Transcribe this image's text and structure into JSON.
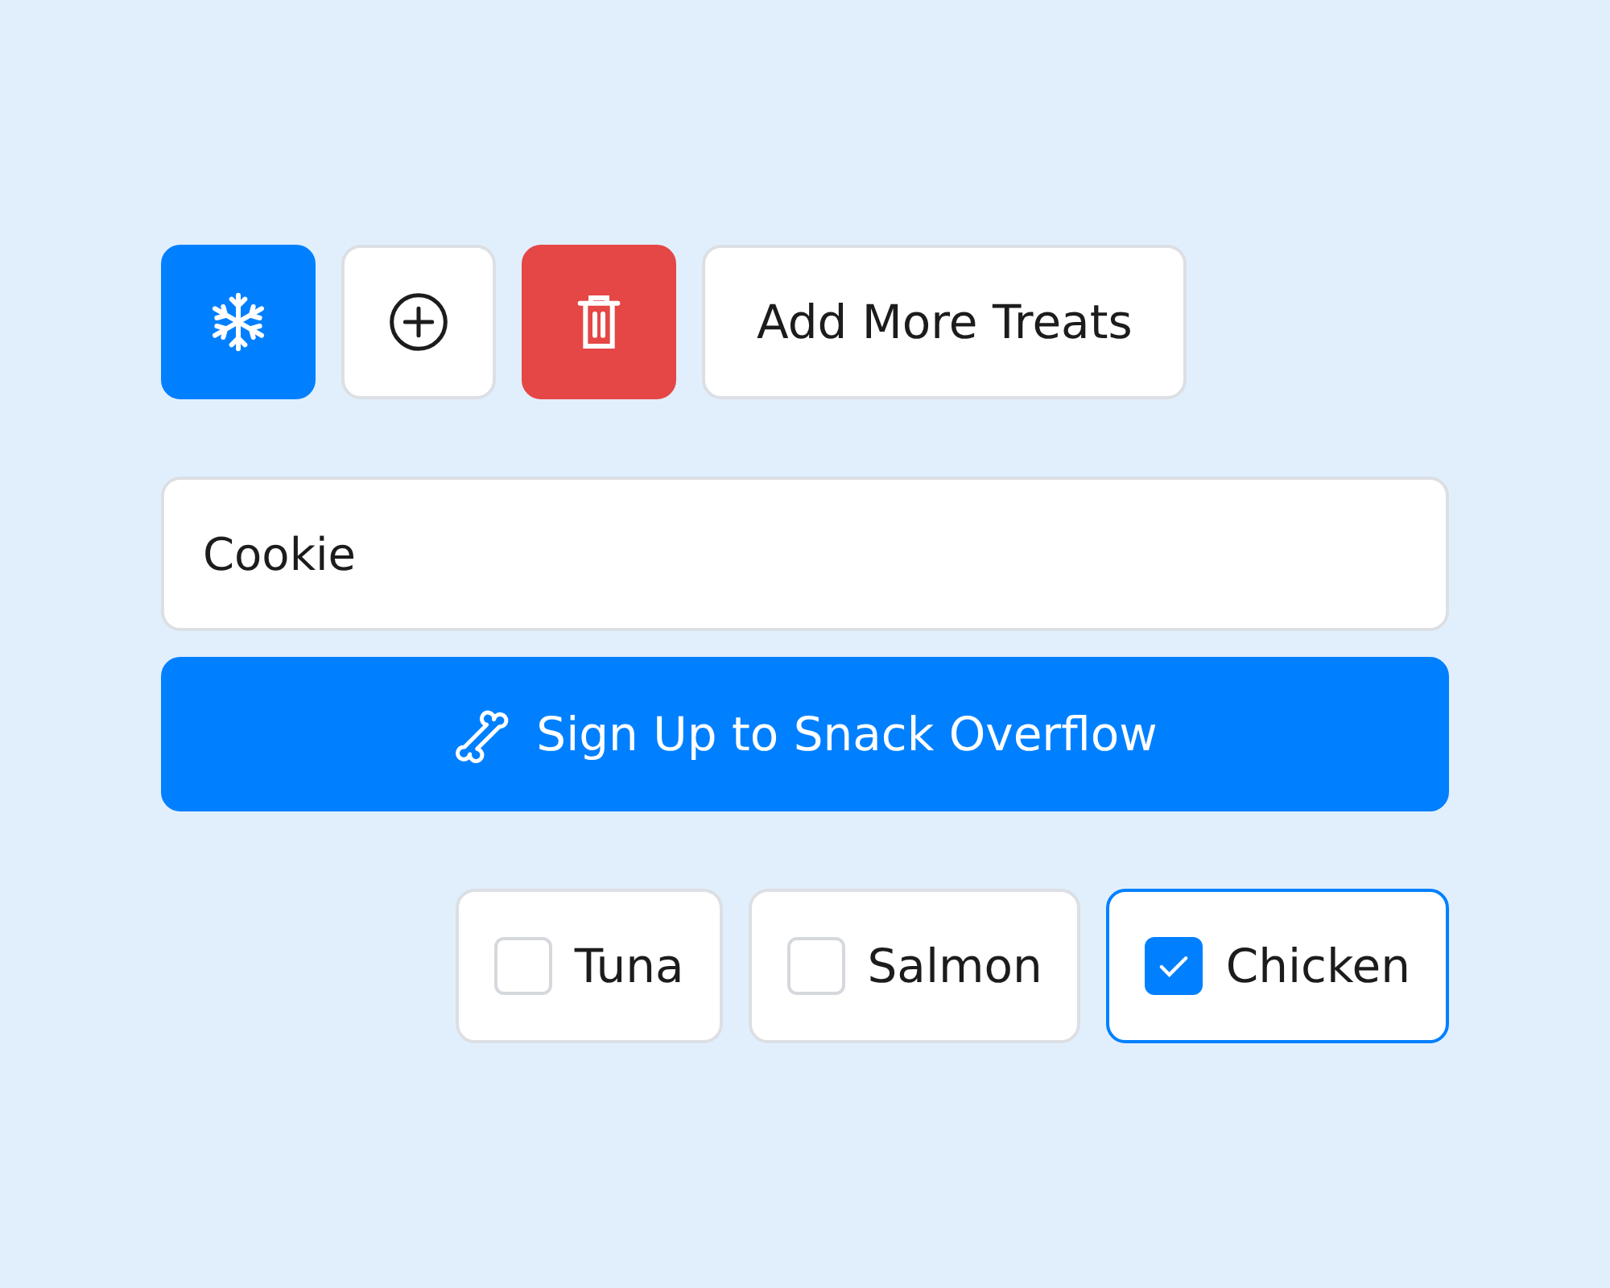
{
  "toolbar": [
    {
      "kind": "snowflake"
    },
    {
      "kind": "add"
    },
    {
      "kind": "delete"
    },
    {
      "kind": "text",
      "label": "Add More Treats"
    }
  ],
  "name_field": {
    "value": "Cookie"
  },
  "signup_button": {
    "label": "Sign Up to Snack Overflow"
  },
  "options": [
    {
      "label": "Tuna",
      "checked": false
    },
    {
      "label": "Salmon",
      "checked": false
    },
    {
      "label": "Chicken",
      "checked": true
    }
  ]
}
